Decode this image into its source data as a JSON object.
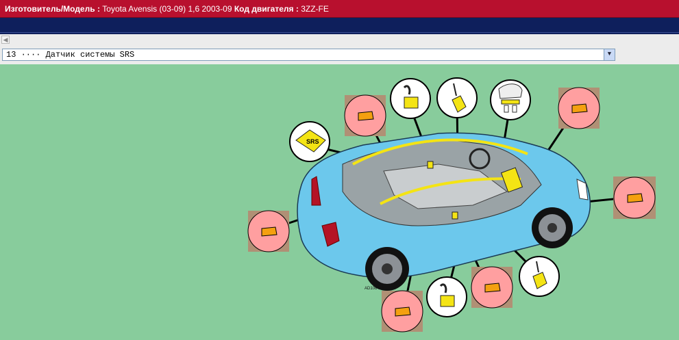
{
  "header": {
    "model_label": "Изготовитель/Модель :",
    "model_value": "Toyota Avensis (03-09) 1,6 2003-09",
    "engine_label": "Код двигателя :",
    "engine_value": "3ZZ-FE"
  },
  "selector": {
    "value": "13 ···· Датчик системы SRS"
  },
  "diagram": {
    "srs_label": "SRS",
    "image_code": "AD108479"
  },
  "colors": {
    "header_bg": "#b8102e",
    "nav_bg": "#0e1f5c",
    "page_bg": "#88cc9c",
    "car_body": "#6cc8ec",
    "component_yellow": "#f4e414",
    "connector_bg": "#ff9fa0",
    "connector_square": "#b09075"
  },
  "icons": [
    "scroll-left-icon",
    "dropdown-arrow-icon",
    "srs-module-icon",
    "connector-icon",
    "sensor-icon"
  ]
}
